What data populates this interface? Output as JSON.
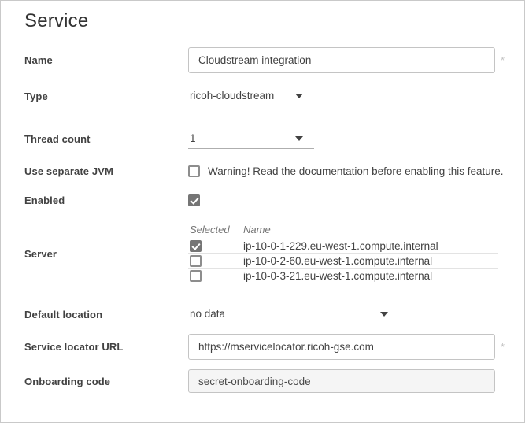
{
  "page": {
    "title": "Service"
  },
  "colors": {
    "panel_border": "#c9c9c9",
    "label_text": "#424242",
    "checkbox_checked": "#757575",
    "input_border": "#c4c4c4",
    "disabled_input_bg": "#f5f5f5",
    "required_marker": "#c2c2c2",
    "table_header_text": "#757575",
    "row_divider": "#e3e3e3"
  },
  "fields": {
    "name": {
      "label": "Name",
      "value": "Cloudstream integration",
      "required_marker": "*"
    },
    "type": {
      "label": "Type",
      "value": "ricoh-cloudstream"
    },
    "thread_count": {
      "label": "Thread count",
      "value": "1"
    },
    "use_separate_jvm": {
      "label": "Use separate JVM",
      "checked": false,
      "warning": "Warning! Read the documentation before enabling this feature."
    },
    "enabled": {
      "label": "Enabled",
      "checked": true
    },
    "server": {
      "label": "Server",
      "columns": {
        "selected": "Selected",
        "name": "Name"
      },
      "rows": [
        {
          "selected": true,
          "name": "ip-10-0-1-229.eu-west-1.compute.internal"
        },
        {
          "selected": false,
          "name": "ip-10-0-2-60.eu-west-1.compute.internal"
        },
        {
          "selected": false,
          "name": "ip-10-0-3-21.eu-west-1.compute.internal"
        }
      ]
    },
    "default_location": {
      "label": "Default location",
      "value": "no data"
    },
    "service_locator_url": {
      "label": "Service locator URL",
      "value": "https://mservicelocator.ricoh-gse.com",
      "required_marker": "*"
    },
    "onboarding_code": {
      "label": "Onboarding code",
      "value": "secret-onboarding-code"
    }
  }
}
